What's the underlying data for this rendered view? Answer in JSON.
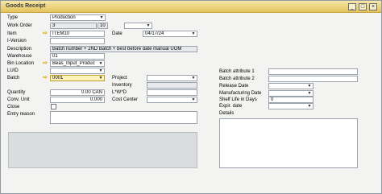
{
  "window": {
    "title": "Goods Receipt",
    "buttons": {
      "minimize": "_",
      "maximize": "□",
      "close": "×"
    }
  },
  "form": {
    "type": {
      "label": "Type",
      "value": "Production"
    },
    "work_order": {
      "label": "Work Order",
      "value1": "3",
      "value2": "10",
      "value3": ""
    },
    "item": {
      "label": "Item",
      "value": "ITEM10"
    },
    "date": {
      "label": "Date",
      "value": "04/17/24"
    },
    "i_version": {
      "label": "I-Version",
      "value": ""
    },
    "description": {
      "label": "Description",
      "value": "Batch number + 2ND Batch + best before date manual UOM"
    },
    "warehouse": {
      "label": "Warehouse",
      "value": "01"
    },
    "bin_location": {
      "label": "Bin Location",
      "value": "Beas_Input_Produc"
    },
    "luid": {
      "label": "LUID",
      "value": ""
    },
    "batch": {
      "label": "Batch",
      "value": "0001"
    },
    "project": {
      "label": "Project",
      "value": ""
    },
    "inventory": {
      "label": "Inventory",
      "value": ""
    },
    "quantity": {
      "label": "Quantity",
      "value": "0.00 CAN"
    },
    "lwd": {
      "label": "L*W*D",
      "value": ""
    },
    "conv_unit": {
      "label": "Conv. Unit",
      "value": "0.000"
    },
    "cost_center": {
      "label": "Cost Center",
      "value": ""
    },
    "close": {
      "label": "Close"
    },
    "entry_reason": {
      "label": "Entry reason",
      "value": ""
    }
  },
  "batch_panel": {
    "attr1": {
      "label": "Batch attribute 1",
      "value": ""
    },
    "attr2": {
      "label": "Batch attribute 2",
      "value": ""
    },
    "release_date": {
      "label": "Release Date",
      "value": ""
    },
    "manufacturing_date": {
      "label": "Manufacturing Date",
      "value": ""
    },
    "shelf_life": {
      "label": "Shelf Life in Days",
      "value": "0"
    },
    "expir_date": {
      "label": "Expir. date",
      "value": ""
    },
    "details": {
      "label": "Details",
      "value": ""
    }
  },
  "icons": {
    "link_arrow": "⇨",
    "dropdown": "▼"
  },
  "colors": {
    "title_bar": "#e3c45c",
    "active_field": "#fff4b8",
    "link_arrow": "#e0a800"
  }
}
